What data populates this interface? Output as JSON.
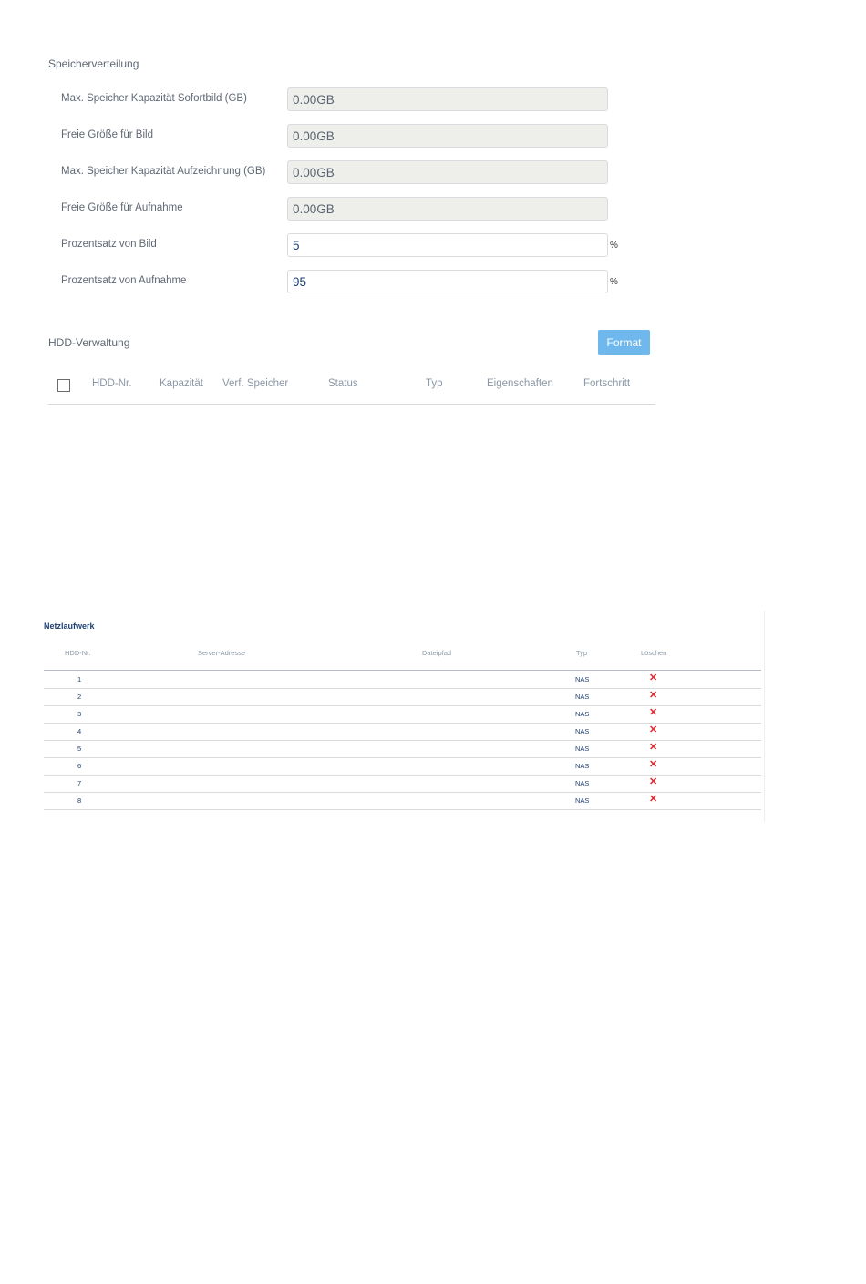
{
  "speicherverteilung": {
    "title": "Speicherverteilung",
    "rows": [
      {
        "label": "Max. Speicher Kapazität Sofortbild (GB)",
        "value": "0.00GB",
        "unit": ""
      },
      {
        "label": "Freie Größe für Bild",
        "value": "0.00GB",
        "unit": ""
      },
      {
        "label": "Max. Speicher Kapazität Aufzeichnung (GB)",
        "value": "0.00GB",
        "unit": ""
      },
      {
        "label": "Freie Größe für Aufnahme",
        "value": "0.00GB",
        "unit": ""
      },
      {
        "label": "Prozentsatz von Bild",
        "value": "5",
        "unit": "%"
      },
      {
        "label": "Prozentsatz von Aufnahme",
        "value": "95",
        "unit": "%"
      }
    ]
  },
  "hdd_verwaltung": {
    "title": "HDD-Verwaltung",
    "format_label": "Format",
    "columns": [
      "HDD-Nr.",
      "Kapazität",
      "Verf. Speicher",
      "Status",
      "Typ",
      "Eigenschaften",
      "Fortschritt"
    ]
  },
  "netzlaufwerk": {
    "title": "Netzlaufwerk",
    "columns": [
      "HDD-Nr.",
      "Server-Adresse",
      "Dateipfad",
      "Typ",
      "Löschen"
    ],
    "delete_icon": "close-icon",
    "rows": [
      {
        "no": "1",
        "typ": "NAS"
      },
      {
        "no": "2",
        "typ": "NAS"
      },
      {
        "no": "3",
        "typ": "NAS"
      },
      {
        "no": "4",
        "typ": "NAS"
      },
      {
        "no": "5",
        "typ": "NAS"
      },
      {
        "no": "6",
        "typ": "NAS"
      },
      {
        "no": "7",
        "typ": "NAS"
      },
      {
        "no": "8",
        "typ": "NAS"
      }
    ]
  },
  "colors": {
    "accent": "#6fb8ee",
    "delete": "#e0262e",
    "value_text": "#1d3f73"
  }
}
